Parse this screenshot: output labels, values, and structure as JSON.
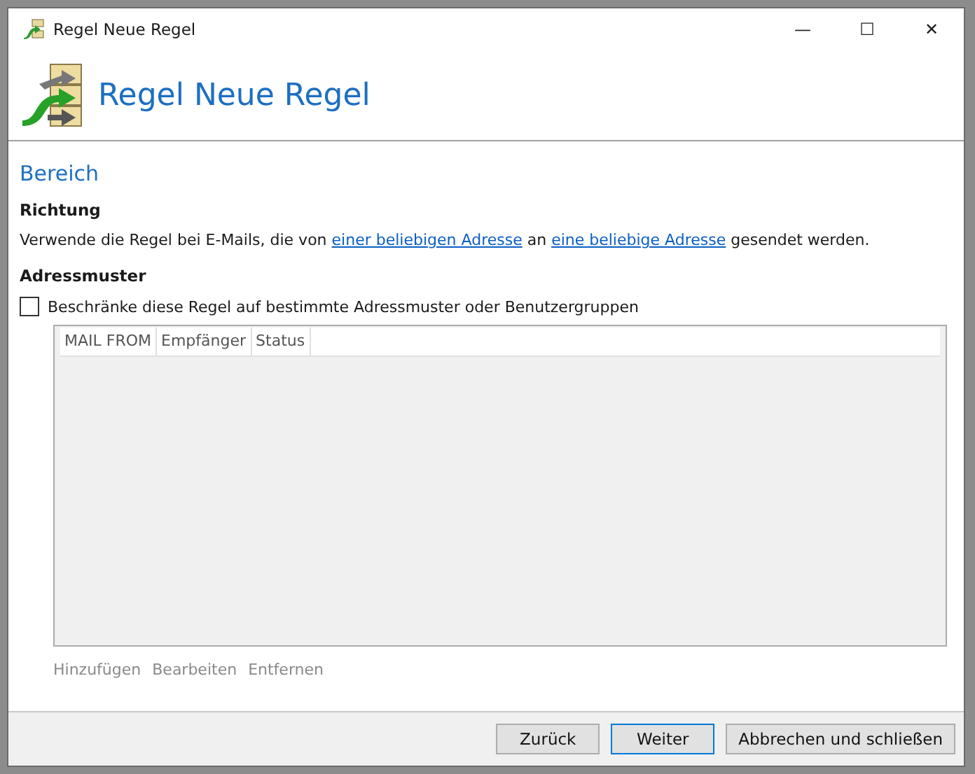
{
  "window": {
    "title": "Regel Neue Regel",
    "controls": [
      "—",
      "☐",
      "✕"
    ]
  },
  "header": {
    "title": "Regel Neue Regel"
  },
  "section": {
    "title": "Bereich"
  },
  "direction": {
    "heading": "Richtung",
    "parts": [
      {
        "kind": "text",
        "text": "Verwende die Regel bei E-Mails, die von "
      },
      {
        "kind": "link",
        "text": "einer beliebigen Adresse"
      },
      {
        "kind": "text",
        "text": " an "
      },
      {
        "kind": "link",
        "text": "eine beliebige Adresse"
      },
      {
        "kind": "text",
        "text": " gesendet werden."
      }
    ]
  },
  "address_pattern": {
    "heading": "Adressmuster",
    "checkbox": {
      "label": "Beschränke diese Regel auf bestimmte Adressmuster oder Benutzergruppen",
      "checked": false
    }
  },
  "table": {
    "columns": [
      "MAIL FROM",
      "Empfänger",
      "Status"
    ]
  },
  "actions": [
    {
      "label": "Hinzufügen",
      "disabled": true
    },
    {
      "label": "Bearbeiten",
      "disabled": true
    },
    {
      "label": "Entfernen",
      "disabled": true
    }
  ],
  "buttons": [
    {
      "label": "Zurück",
      "focused": false
    },
    {
      "label": "Weiter",
      "focused": true
    },
    {
      "label": "Abbrechen und schließen",
      "focused": false
    }
  ]
}
